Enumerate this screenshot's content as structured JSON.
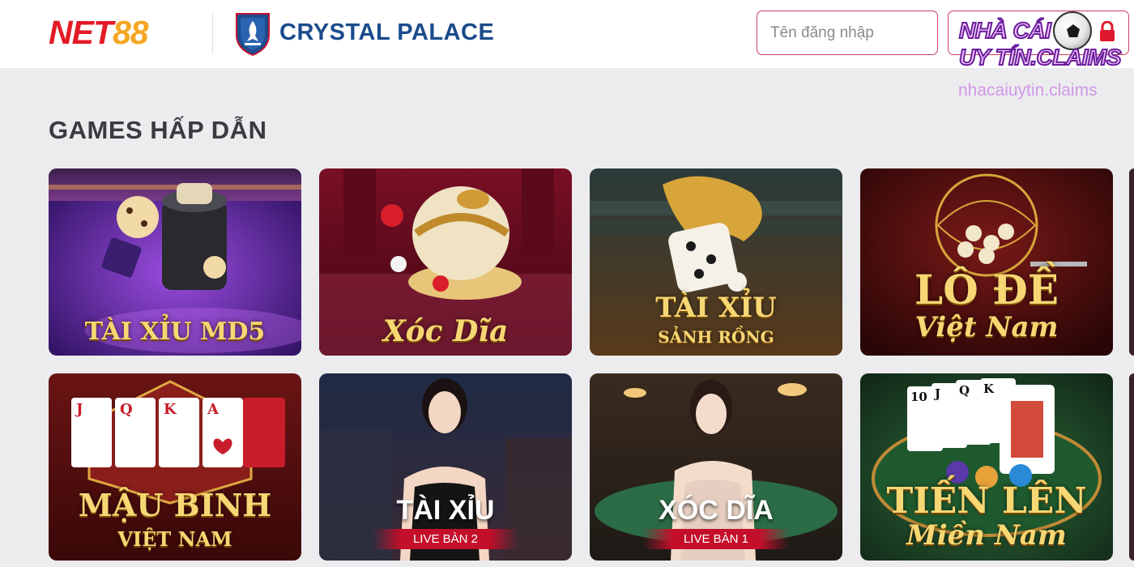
{
  "header": {
    "logo_net88_part1": "NET",
    "logo_net88_part2": "88",
    "partner_name": "CRYSTAL PALACE",
    "username_placeholder": "Tên đăng nhập"
  },
  "watermark": {
    "badge_line1": "NHÀ CÁI",
    "badge_line2": "UY TÍN.CLAIMS",
    "url": "nhacaiuytin.claims"
  },
  "section": {
    "title": "GAMES HẤP DẪN"
  },
  "games": [
    {
      "name": "TÀI XỈU MD5"
    },
    {
      "name": "Xóc Dĩa"
    },
    {
      "name": "TÀI XỈU",
      "subtitle": "SẢNH RỒNG"
    },
    {
      "name": "LÔ ĐỀ",
      "subtitle": "Việt Nam"
    },
    {
      "name": "MẬU BINH",
      "subtitle": "VIỆT NAM"
    },
    {
      "name": "TÀI XỈU",
      "badge": "LIVE BÀN 2"
    },
    {
      "name": "XÓC DĨA",
      "badge": "LIVE BÀN 1"
    },
    {
      "name": "TIẾN LÊN",
      "subtitle": "Miền Nam"
    }
  ],
  "colors": {
    "brand_red": "#e21b26",
    "brand_orange": "#f5a623",
    "partner_blue": "#1b4c8c",
    "input_border": "#cf3d60",
    "live_badge": "#c40f2a"
  }
}
